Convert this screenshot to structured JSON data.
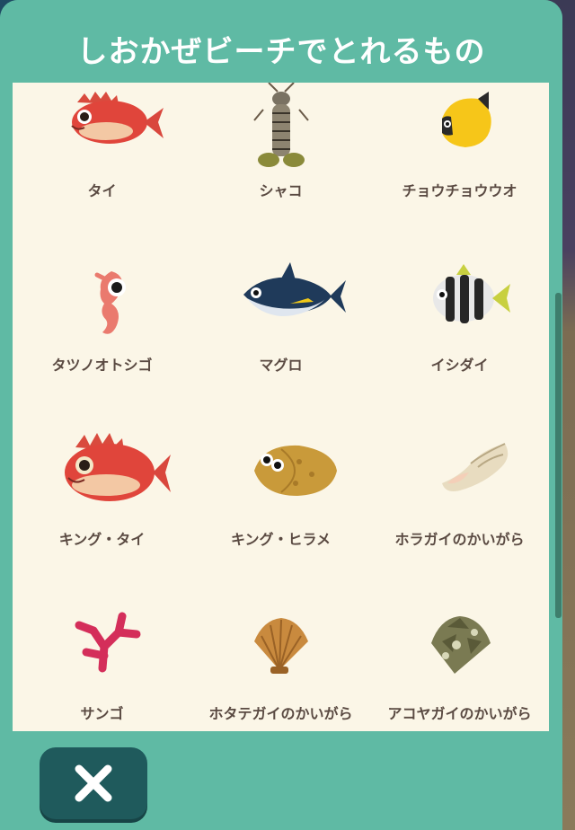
{
  "header": {
    "title": "しおかぜビーチでとれるもの"
  },
  "items": [
    {
      "label": "タイ",
      "icon": "red-snapper-icon"
    },
    {
      "label": "シャコ",
      "icon": "mantis-shrimp-icon"
    },
    {
      "label": "チョウチョウウオ",
      "icon": "butterflyfish-icon"
    },
    {
      "label": "タツノオトシゴ",
      "icon": "seahorse-icon"
    },
    {
      "label": "マグロ",
      "icon": "tuna-icon"
    },
    {
      "label": "イシダイ",
      "icon": "striped-beakfish-icon"
    },
    {
      "label": "キング・タイ",
      "icon": "king-snapper-icon"
    },
    {
      "label": "キング・ヒラメ",
      "icon": "king-flounder-icon"
    },
    {
      "label": "ホラガイのかいがら",
      "icon": "conch-shell-icon"
    },
    {
      "label": "サンゴ",
      "icon": "coral-icon"
    },
    {
      "label": "ホタテガイのかいがら",
      "icon": "scallop-shell-icon"
    },
    {
      "label": "アコヤガイのかいがら",
      "icon": "pearl-oyster-shell-icon"
    }
  ],
  "footer": {
    "close_icon": "close-icon"
  },
  "colors": {
    "teal": "#5fbaa4",
    "cream": "#fbf6e7",
    "button": "#1f5a5c",
    "label": "#5a4a42"
  }
}
